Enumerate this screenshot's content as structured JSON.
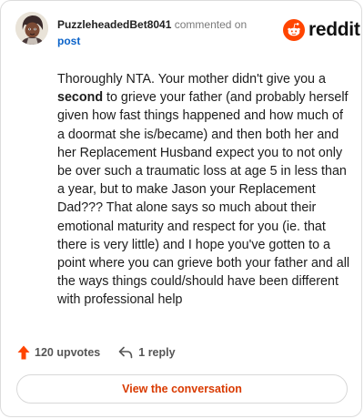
{
  "header": {
    "username": "PuzzleheadedBet8041",
    "action_text": "commented on",
    "post_link": "post"
  },
  "brand": {
    "wordmark": "reddit",
    "accent_color": "#ff4500",
    "icon": "reddit-snoo-icon"
  },
  "comment": {
    "text_before_bold": "Thoroughly NTA. Your mother didn't give you a ",
    "bold_word": "second",
    "text_after_bold": " to grieve your father (and probably herself given how fast things happened and how much of a doormat she is/became) and then both her and her Replacement Husband expect you to not only be over such a traumatic loss at age 5 in less than a year, but to make Jason your Replacement Dad??? That alone says so much about their emotional maturity and respect for you (ie. that there is very little) and I hope you've gotten to a point where you can grieve both your father and all the ways things could/should have been different with professional help"
  },
  "actions": {
    "upvotes_label": "120 upvotes",
    "upvote_icon": "upvote-arrow-icon",
    "upvote_color": "#ff4500",
    "replies_label": "1 reply",
    "reply_icon": "reply-arrow-icon"
  },
  "footer": {
    "view_conversation_label": "View the conversation",
    "button_text_color": "#d93a00"
  }
}
